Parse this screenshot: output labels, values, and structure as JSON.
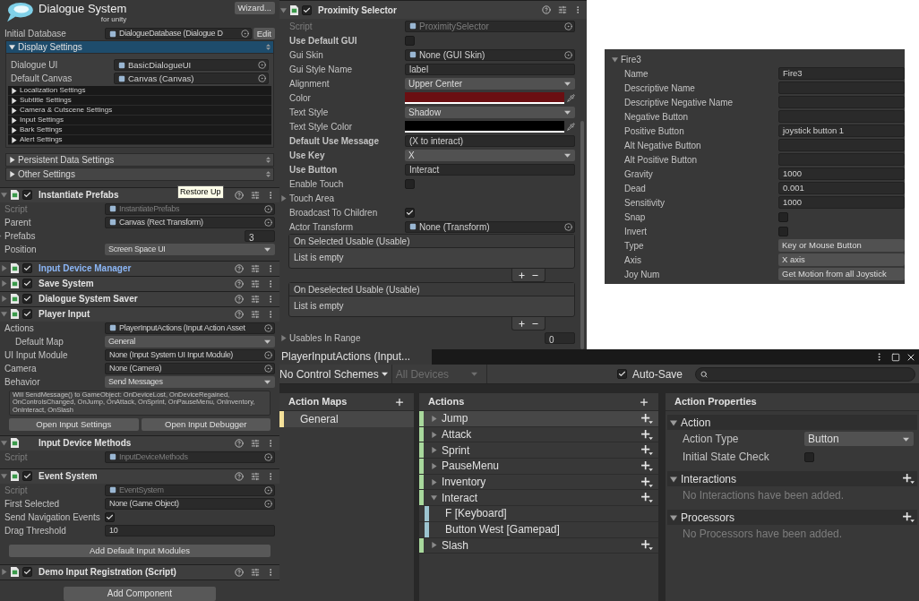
{
  "dialogue_manager": {
    "title": "Dialogue System",
    "subtitle": "for unity",
    "wizard": "Wizard...",
    "initial_database": {
      "label": "Initial Database",
      "value": "DialogueDatabase (Dialogue D",
      "edit": "Edit"
    },
    "display_settings": {
      "title": "Display Settings",
      "expanded": true,
      "fields": [
        {
          "kind": "object",
          "label": "Dialogue UI",
          "value": "BasicDialogueUI",
          "icon": true
        },
        {
          "kind": "object",
          "label": "Default Canvas",
          "value": "Canvas (Canvas)",
          "icon": true
        }
      ],
      "subsections": [
        {
          "title": "Localization Settings",
          "expanded": false
        },
        {
          "title": "Subtitle Settings",
          "expanded": false
        },
        {
          "title": "Camera & Cutscene Settings",
          "expanded": false
        },
        {
          "title": "Input Settings",
          "expanded": false
        },
        {
          "title": "Bark Settings",
          "expanded": false
        },
        {
          "title": "Alert Settings",
          "expanded": false
        }
      ]
    },
    "sections": [
      {
        "title": "Persistent Data Settings",
        "expanded": false
      },
      {
        "title": "Other Settings",
        "expanded": false
      }
    ]
  },
  "components": [
    {
      "title": "Instantiate Prefabs",
      "enabled": true,
      "expanded": true,
      "highlighted": false,
      "tooltip": "Restore Up",
      "fields": [
        {
          "kind": "script",
          "label": "Script",
          "value": "InstantiatePrefabs",
          "icon": true
        },
        {
          "kind": "object",
          "label": "Parent",
          "value": "Canvas (Rect Transform)",
          "icon": true
        },
        {
          "kind": "foldout",
          "label": "Prefabs",
          "expanded": false,
          "value": "3"
        },
        {
          "kind": "dropdown",
          "label": "Position",
          "value": "Screen Space UI"
        }
      ]
    },
    {
      "title": "Input Device Manager",
      "enabled": true,
      "expanded": false,
      "highlighted": true
    },
    {
      "title": "Save System",
      "enabled": true,
      "expanded": false,
      "highlighted": false
    },
    {
      "title": "Dialogue System Saver",
      "enabled": true,
      "expanded": false,
      "highlighted": false
    },
    {
      "title": "Player Input",
      "enabled": true,
      "expanded": true,
      "highlighted": false,
      "fields": [
        {
          "kind": "object",
          "label": "Actions",
          "value": "PlayerInputActions (Input Action Asset",
          "icon": true,
          "children": [
            {
              "kind": "dropdown",
              "label": "Default Map",
              "value": "General"
            }
          ]
        },
        {
          "kind": "object",
          "label": "UI Input Module",
          "value": "None (Input System UI Input Module)"
        },
        {
          "kind": "object",
          "label": "Camera",
          "value": "None (Camera)"
        },
        {
          "kind": "dropdown",
          "label": "Behavior",
          "value": "Send Messages"
        },
        {
          "kind": "help",
          "text": "Will SendMessage() to GameObject: OnDeviceLost, OnDeviceRegained, OnControlsChanged, OnJump, OnAttack, OnSprint, OnPauseMenu, OnInventory, OnInteract, OnSlash"
        },
        {
          "kind": "buttons",
          "labels": [
            "Open Input Settings",
            "Open Input Debugger"
          ]
        }
      ]
    },
    {
      "title": "Input Device Methods",
      "expanded": true,
      "highlighted": false,
      "fields": [
        {
          "kind": "script",
          "label": "Script",
          "value": "InputDeviceMethods",
          "icon": true
        }
      ]
    },
    {
      "title": "Event System",
      "enabled": true,
      "expanded": true,
      "highlighted": false,
      "fields": [
        {
          "kind": "script",
          "label": "Script",
          "value": "EventSystem",
          "icon": true
        },
        {
          "kind": "object",
          "label": "First Selected",
          "value": "None (Game Object)"
        },
        {
          "kind": "checkbox",
          "label": "Send Navigation Events",
          "checked": true
        },
        {
          "kind": "text",
          "label": "Drag Threshold",
          "value": "10"
        },
        {
          "kind": "button",
          "label": "Add Default Input Modules"
        }
      ]
    },
    {
      "title": "Demo Input Registration (Script)",
      "enabled": true,
      "expanded": false,
      "highlighted": false
    }
  ],
  "add_component": "Add Component",
  "proximity_selector": {
    "title": "Proximity Selector",
    "enabled": true,
    "expanded": true,
    "fields": [
      {
        "kind": "script",
        "label": "Script",
        "value": "ProximitySelector",
        "icon": true
      },
      {
        "kind": "checkbox",
        "label": "Use Default GUI",
        "bold": true,
        "checked": false
      },
      {
        "kind": "object",
        "label": "Gui Skin",
        "value": "None (GUI Skin)",
        "icon": true
      },
      {
        "kind": "text",
        "label": "Gui Style Name",
        "value": "label"
      },
      {
        "kind": "dropdown",
        "label": "Alignment",
        "value": "Upper Center"
      },
      {
        "kind": "color",
        "label": "Color",
        "color": "#6b0f12"
      },
      {
        "kind": "dropdown",
        "label": "Text Style",
        "value": "Shadow"
      },
      {
        "kind": "color",
        "label": "Text Style Color",
        "color": "#000000"
      },
      {
        "kind": "text",
        "label": "Default Use Message",
        "bold": true,
        "value": "(X to interact)"
      },
      {
        "kind": "dropdown",
        "label": "Use Key",
        "bold": true,
        "value": "X"
      },
      {
        "kind": "text",
        "label": "Use Button",
        "bold": true,
        "value": "Interact"
      },
      {
        "kind": "checkbox",
        "label": "Enable Touch",
        "checked": false
      },
      {
        "kind": "foldout",
        "label": "Touch Area",
        "expanded": false
      },
      {
        "kind": "checkbox",
        "label": "Broadcast To Children",
        "checked": true
      },
      {
        "kind": "object",
        "label": "Actor Transform",
        "value": "None (Transform)",
        "icon": true
      },
      {
        "kind": "event",
        "label": "On Selected Usable (Usable)",
        "empty": "List is empty"
      },
      {
        "kind": "event",
        "label": "On Deselected Usable (Usable)",
        "empty": "List is empty"
      },
      {
        "kind": "foldout",
        "label": "Usables In Range",
        "expanded": false,
        "value": "0"
      }
    ]
  },
  "input_axis": {
    "title": "Fire3",
    "expanded": true,
    "rows": [
      {
        "kind": "text",
        "label": "Name",
        "value": "Fire3"
      },
      {
        "kind": "text",
        "label": "Descriptive Name"
      },
      {
        "kind": "text",
        "label": "Descriptive Negative Name"
      },
      {
        "kind": "text",
        "label": "Negative Button"
      },
      {
        "kind": "text",
        "label": "Positive Button",
        "value": "joystick button 1"
      },
      {
        "kind": "text",
        "label": "Alt Negative Button"
      },
      {
        "kind": "text",
        "label": "Alt Positive Button"
      },
      {
        "kind": "text",
        "label": "Gravity",
        "value": "1000"
      },
      {
        "kind": "text",
        "label": "Dead",
        "value": "0.001"
      },
      {
        "kind": "text",
        "label": "Sensitivity",
        "value": "1000"
      },
      {
        "kind": "checkbox",
        "label": "Snap",
        "checked": false
      },
      {
        "kind": "checkbox",
        "label": "Invert",
        "checked": false
      },
      {
        "kind": "dropdown",
        "label": "Type",
        "value": "Key or Mouse Button"
      },
      {
        "kind": "dropdown",
        "label": "Axis",
        "value": "X axis"
      },
      {
        "kind": "dropdown",
        "label": "Joy Num",
        "value": "Get Motion from all Joystick"
      }
    ]
  },
  "input_actions": {
    "tab": "PlayerInputActions (Input...",
    "control_schemes": "No Control Schemes",
    "devices": {
      "label": "All Devices",
      "disabled": true
    },
    "auto_save": {
      "label": "Auto-Save",
      "checked": true
    },
    "action_maps": {
      "title": "Action Maps",
      "items": [
        {
          "label": "General",
          "selected": true
        }
      ]
    },
    "actions": {
      "title": "Actions",
      "items": [
        {
          "label": "Jump",
          "selected": true,
          "expanded": false
        },
        {
          "label": "Attack",
          "selected": false,
          "expanded": false
        },
        {
          "label": "Sprint",
          "selected": false,
          "expanded": false
        },
        {
          "label": "PauseMenu",
          "selected": false,
          "expanded": false
        },
        {
          "label": "Inventory",
          "selected": false,
          "expanded": false
        },
        {
          "label": "Interact",
          "selected": false,
          "expanded": true,
          "children": [
            {
              "label": "F [Keyboard]",
              "selected": false
            },
            {
              "label": "Button West [Gamepad]",
              "selected": false
            }
          ]
        },
        {
          "label": "Slash",
          "selected": false,
          "expanded": false
        }
      ]
    },
    "properties": {
      "title": "Action Properties",
      "sections": [
        {
          "title": "Action",
          "expanded": true,
          "can_add": false,
          "fields": [
            {
              "kind": "dropdown",
              "label": "Action Type",
              "value": "Button"
            },
            {
              "kind": "checkbox",
              "label": "Initial State Check",
              "checked": false
            }
          ]
        },
        {
          "title": "Interactions",
          "expanded": true,
          "can_add": true,
          "empty": "No Interactions have been added."
        },
        {
          "title": "Processors",
          "expanded": true,
          "can_add": true,
          "empty": "No Processors have been added."
        }
      ]
    }
  }
}
